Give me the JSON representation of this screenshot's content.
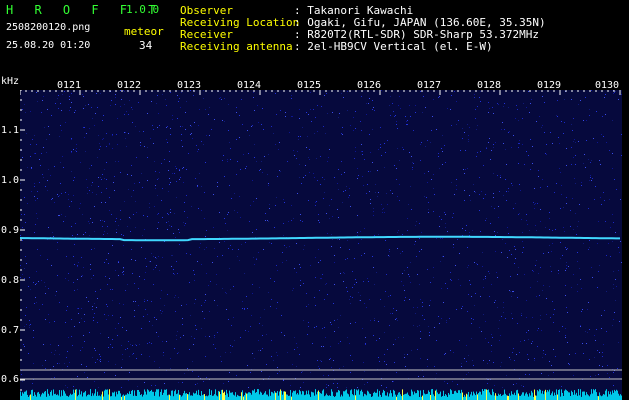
{
  "header": {
    "app_title": "H R O F F T",
    "version": "1.0.0",
    "filename": "2508200120.png",
    "timestamp": "25.08.20 01:20",
    "meteor_label": "meteor",
    "meteor_count": "34",
    "fields": [
      {
        "label": "Observer",
        "value": ": Takanori Kawachi"
      },
      {
        "label": "Receiving Location",
        "value": ": Ogaki, Gifu, JAPAN (136.60E, 35.35N)"
      },
      {
        "label": "Receiver",
        "value": ": R820T2(RTL-SDR) SDR-Sharp 53.372MHz"
      },
      {
        "label": "Receiving antenna",
        "value": ": 2el-HB9CV Vertical (el. E-W)"
      }
    ]
  },
  "axis": {
    "unit": "kHz",
    "y_ticks": [
      "1.1",
      "1.0",
      "0.9",
      "0.8",
      "0.7",
      "0.6"
    ],
    "x_ticks": [
      "0121",
      "0122",
      "0123",
      "0124",
      "0125",
      "0126",
      "0127",
      "0128",
      "0129",
      "0130"
    ]
  },
  "colors": {
    "background": "#000000",
    "spectrogram_bg": "#06093d",
    "label_green": "#33ff33",
    "label_white": "#ffffff",
    "label_yellow": "#ffff00",
    "signal_trace": "#40d8ff",
    "noise_bar": "#00c8e8"
  }
}
